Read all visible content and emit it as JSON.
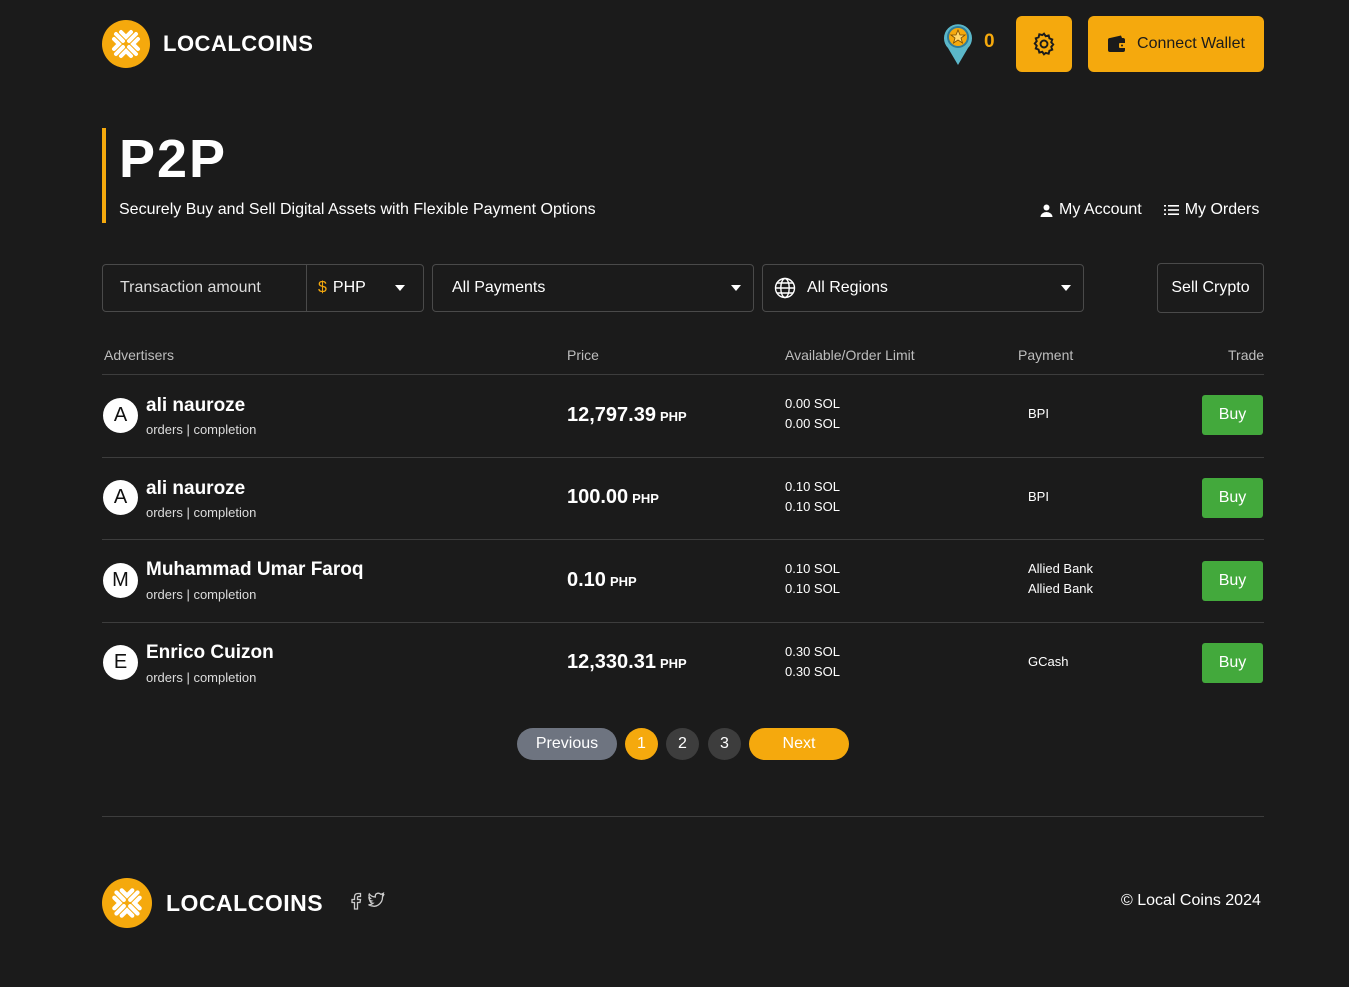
{
  "brand": {
    "name": "LOCALCOINS",
    "accent": "#f5a90d"
  },
  "header": {
    "points": "0",
    "connect_wallet": "Connect Wallet"
  },
  "hero": {
    "title": "P2P",
    "subtitle": "Securely Buy and Sell Digital Assets with Flexible Payment Options",
    "my_account": "My Account",
    "my_orders": "My Orders"
  },
  "filters": {
    "amount_placeholder": "Transaction amount",
    "currency_symbol": "$",
    "currency": "PHP",
    "payments": "All Payments",
    "regions": "All Regions",
    "sell_crypto": "Sell Crypto"
  },
  "table": {
    "headers": [
      "Advertisers",
      "Price",
      "Available/Order Limit",
      "Payment",
      "Trade"
    ],
    "rows": [
      {
        "initial": "A",
        "name": "ali nauroze",
        "meta": "orders | completion",
        "price": "12,797.39",
        "unit": "PHP",
        "available": "0.00 SOL",
        "limit": "0.00 SOL",
        "payment": [
          "BPI"
        ],
        "action": "Buy"
      },
      {
        "initial": "A",
        "name": "ali nauroze",
        "meta": "orders | completion",
        "price": "100.00",
        "unit": "PHP",
        "available": "0.10 SOL",
        "limit": "0.10 SOL",
        "payment": [
          "BPI"
        ],
        "action": "Buy"
      },
      {
        "initial": "M",
        "name": "Muhammad Umar Faroq",
        "meta": "orders | completion",
        "price": "0.10",
        "unit": "PHP",
        "available": "0.10 SOL",
        "limit": "0.10 SOL",
        "payment": [
          "Allied Bank",
          "Allied Bank"
        ],
        "action": "Buy"
      },
      {
        "initial": "E",
        "name": "Enrico Cuizon",
        "meta": "orders | completion",
        "price": "12,330.31",
        "unit": "PHP",
        "available": "0.30 SOL",
        "limit": "0.30 SOL",
        "payment": [
          "GCash"
        ],
        "action": "Buy"
      }
    ]
  },
  "pagination": {
    "previous": "Previous",
    "pages": [
      "1",
      "2",
      "3"
    ],
    "current": "1",
    "next": "Next"
  },
  "footer": {
    "copyright": "© Local Coins 2024"
  }
}
